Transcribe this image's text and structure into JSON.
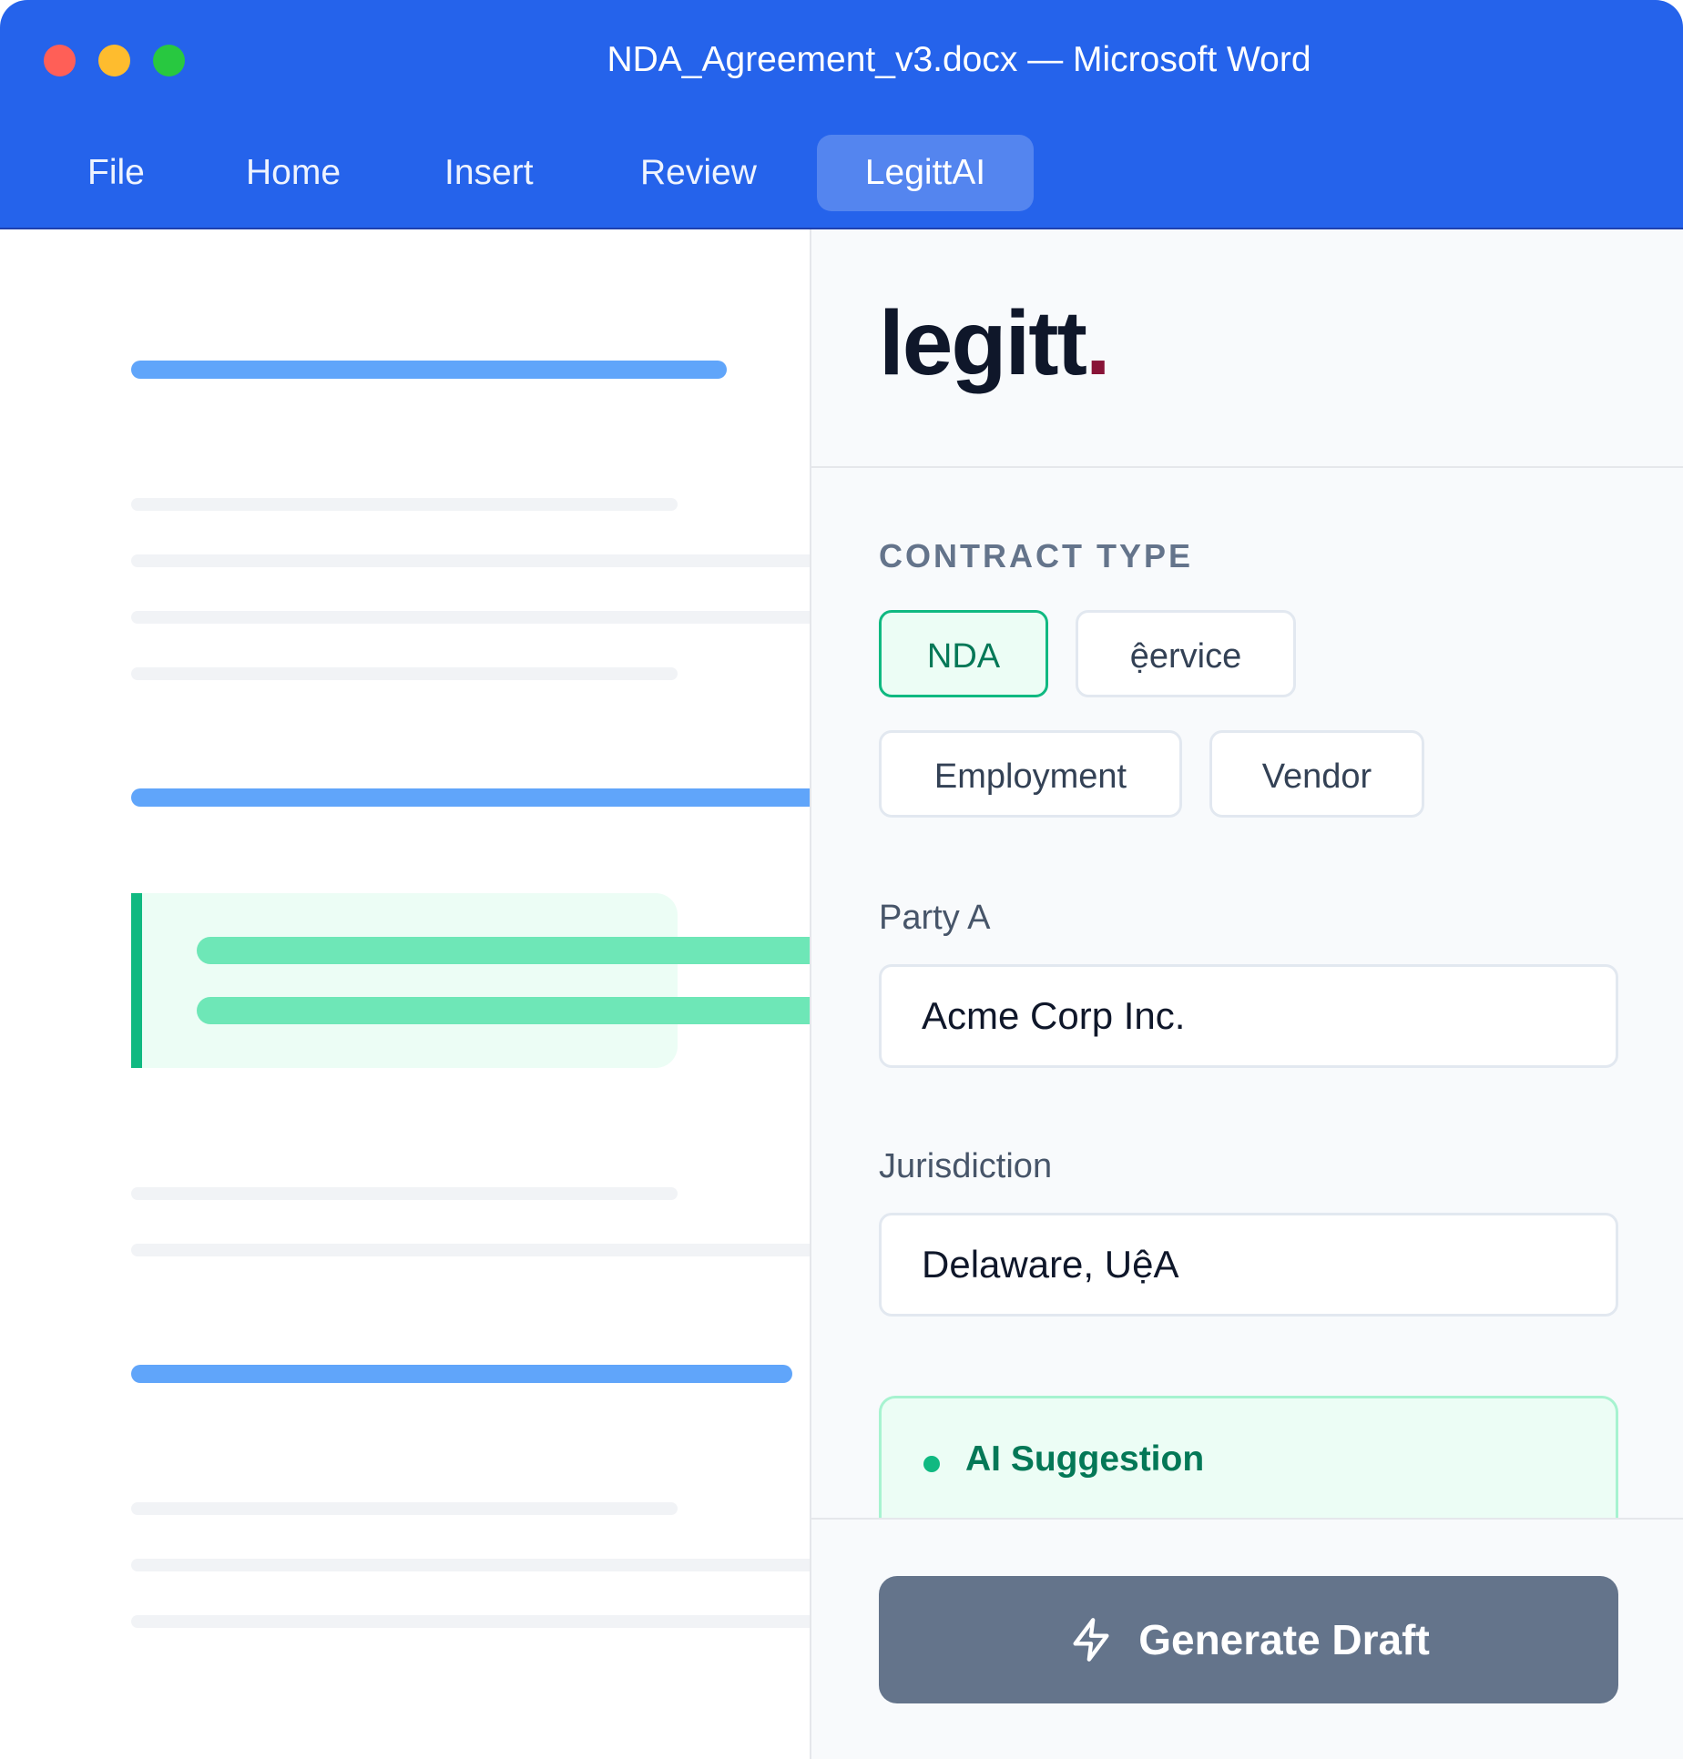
{
  "window": {
    "title": "NDA_Agreement_v3.docx — Microsoft Word"
  },
  "ribbon": {
    "tabs": [
      {
        "label": "File"
      },
      {
        "label": "Home"
      },
      {
        "label": "Insert"
      },
      {
        "label": "Review"
      },
      {
        "label": "LegittAI",
        "active": true
      }
    ]
  },
  "colors": {
    "titlebar": "#2563EB",
    "accent_green": "#10B981",
    "brand_dot": "#881337",
    "button": "#64748B"
  },
  "sidebar": {
    "logo_text": "legitt",
    "logo_dot": ".",
    "contract_type": {
      "label": "CONTRACT TYPE",
      "options": [
        {
          "label": "NDA",
          "selected": true
        },
        {
          "label": "ệervice",
          "selected": false
        },
        {
          "label": "Employment",
          "selected": false
        },
        {
          "label": "Vendor",
          "selected": false
        }
      ]
    },
    "party_a": {
      "label": "Party A",
      "value": "Acme Corp Inc."
    },
    "jurisdiction": {
      "label": "Jurisdiction",
      "value": "Delaware, UệA"
    },
    "suggestion": {
      "title": "AI Suggestion"
    },
    "generate": {
      "label": "Generate Draft",
      "icon": "bolt-icon"
    }
  }
}
